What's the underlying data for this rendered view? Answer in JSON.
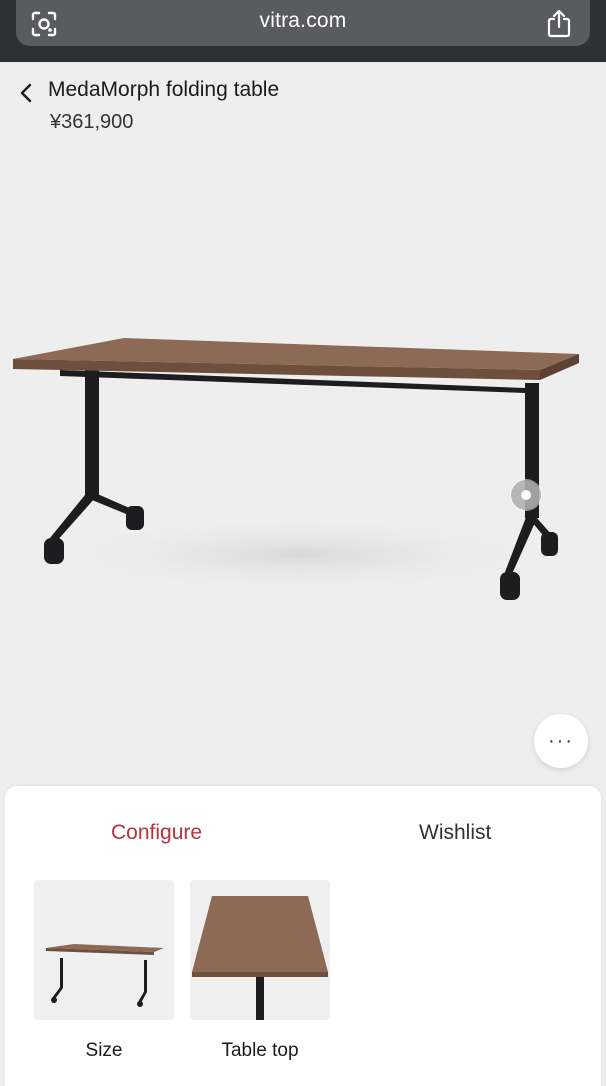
{
  "browser": {
    "url": "vitra.com",
    "icons": [
      "lens-icon",
      "share-icon"
    ]
  },
  "header": {
    "back_icon": "chevron-left-icon",
    "title": "MedaMorph folding table",
    "price": "¥361,900"
  },
  "viewer": {
    "more_label": "···",
    "hotspot_icon": "hotspot-icon"
  },
  "sheet": {
    "tabs": [
      {
        "label": "Configure",
        "active": true
      },
      {
        "label": "Wishlist",
        "active": false
      }
    ],
    "options": [
      {
        "label": "Size"
      },
      {
        "label": "Table top"
      }
    ]
  },
  "colors": {
    "accent": "#b5323d",
    "table_top": "#8c6a55",
    "frame": "#1d1d1f",
    "background": "#eeeeee"
  }
}
